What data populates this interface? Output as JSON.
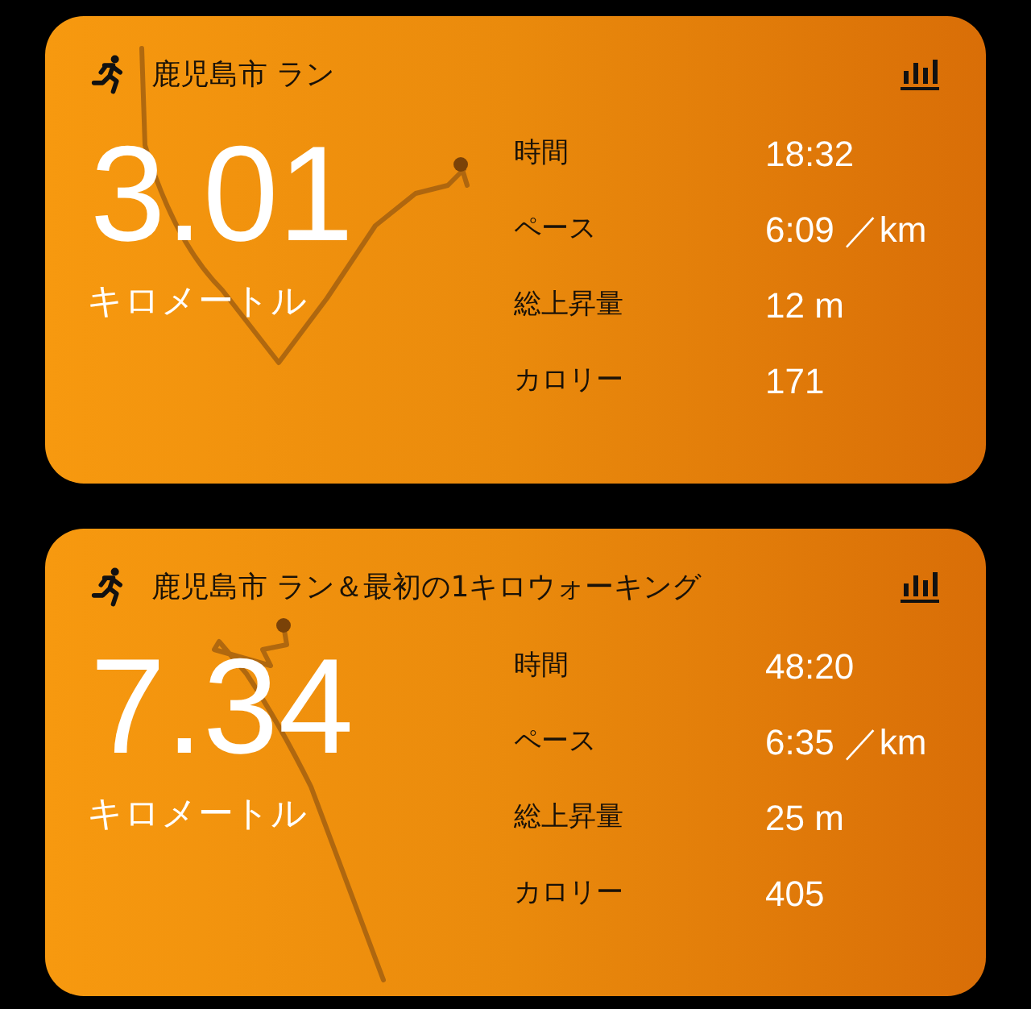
{
  "workouts": [
    {
      "title": "鹿児島市 ラン",
      "distance": "3.01",
      "unit": "キロメートル",
      "stats": [
        {
          "label": "時間",
          "value": "18:32"
        },
        {
          "label": "ペース",
          "value": "6:09 ／km"
        },
        {
          "label": "総上昇量",
          "value": "12 m"
        },
        {
          "label": "カロリー",
          "value": "171"
        }
      ]
    },
    {
      "title": "鹿児島市 ラン＆最初の1キロウォーキング",
      "distance": "7.34",
      "unit": "キロメートル",
      "stats": [
        {
          "label": "時間",
          "value": "48:20"
        },
        {
          "label": "ペース",
          "value": "6:35 ／km"
        },
        {
          "label": "総上昇量",
          "value": "25 m"
        },
        {
          "label": "カロリー",
          "value": "405"
        }
      ]
    }
  ]
}
